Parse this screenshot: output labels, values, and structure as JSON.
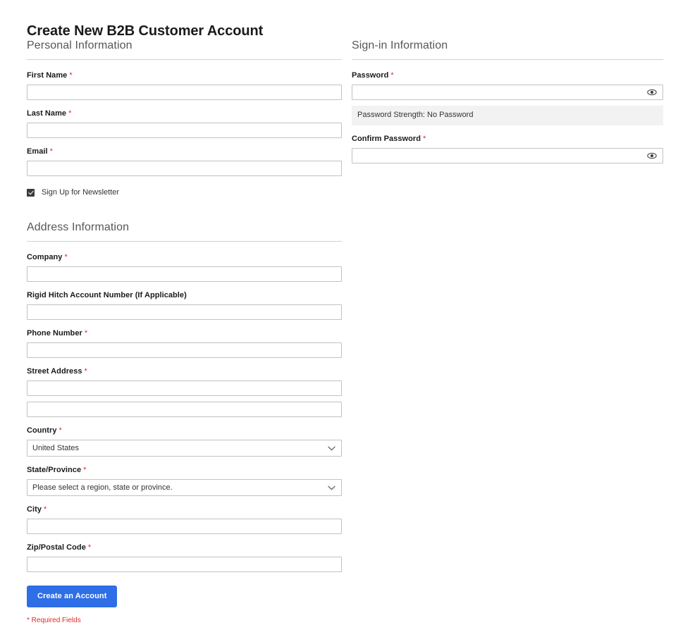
{
  "page": {
    "title": "Create New B2B Customer Account"
  },
  "personal": {
    "legend": "Personal Information",
    "first_name": {
      "label": "First Name",
      "required_mark": "*",
      "value": "",
      "placeholder": ""
    },
    "last_name": {
      "label": "Last Name",
      "required_mark": "*",
      "value": "",
      "placeholder": ""
    },
    "email": {
      "label": "Email",
      "required_mark": "*",
      "value": "",
      "placeholder": ""
    },
    "newsletter": {
      "label": "Sign Up for Newsletter",
      "checked": true
    }
  },
  "signin": {
    "legend": "Sign-in Information",
    "password": {
      "label": "Password",
      "required_mark": "*",
      "value": "",
      "placeholder": "",
      "toggle_icon": "eye-icon"
    },
    "password_strength": "Password Strength: No Password",
    "confirm_password": {
      "label": "Confirm Password",
      "required_mark": "*",
      "value": "",
      "placeholder": "",
      "toggle_icon": "eye-icon"
    }
  },
  "address": {
    "legend": "Address Information",
    "company": {
      "label": "Company",
      "required_mark": "*",
      "value": "",
      "placeholder": ""
    },
    "account_number": {
      "label": "Rigid Hitch Account Number (If Applicable)",
      "required_mark": "",
      "value": "",
      "placeholder": ""
    },
    "phone": {
      "label": "Phone Number",
      "required_mark": "*",
      "value": "",
      "placeholder": ""
    },
    "street": {
      "label": "Street Address",
      "required_mark": "*",
      "value": "",
      "value2": "",
      "placeholder": ""
    },
    "country": {
      "label": "Country",
      "required_mark": "*",
      "selected": "United States",
      "options": [
        "United States"
      ]
    },
    "state": {
      "label": "State/Province",
      "required_mark": "*",
      "selected": "Please select a region, state or province.",
      "options": [
        "Please select a region, state or province."
      ]
    },
    "city": {
      "label": "City",
      "required_mark": "*",
      "value": "",
      "placeholder": ""
    },
    "zip": {
      "label": "Zip/Postal Code",
      "required_mark": "*",
      "value": "",
      "placeholder": ""
    }
  },
  "actions": {
    "submit_label": "Create an Account",
    "required_note": "* Required Fields"
  },
  "colors": {
    "primary_button": "#2e6ee6",
    "required_red": "#e02b27",
    "label_text": "#1a1a1a",
    "legend_text": "#575757",
    "input_border": "#c2c2c2",
    "strength_bg": "#f2f2f2"
  }
}
